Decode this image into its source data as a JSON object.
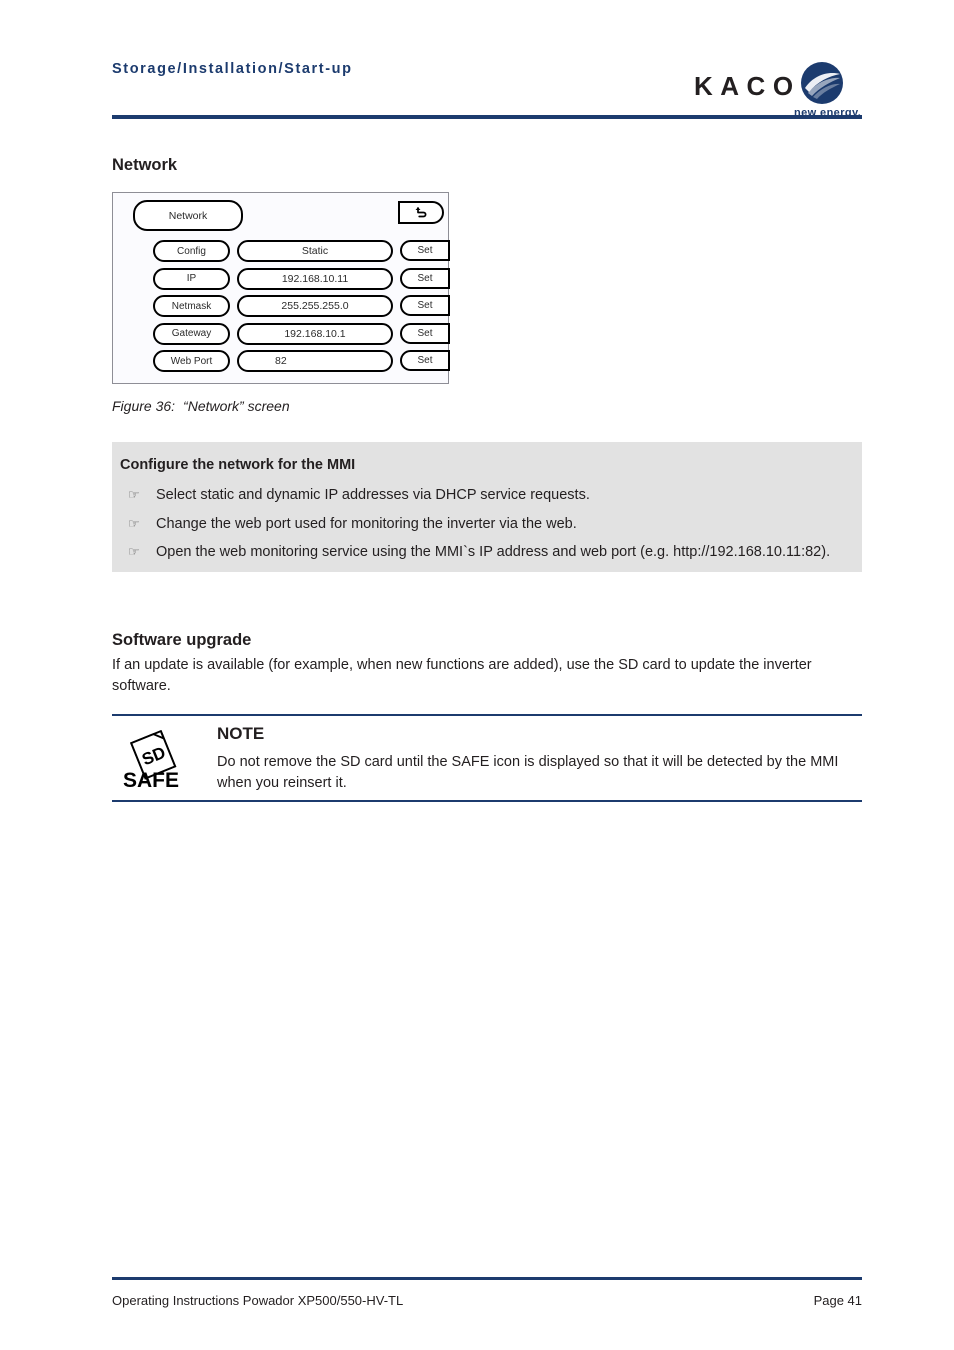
{
  "header": {
    "breadcrumb": "Storage/Installation/Start-up",
    "rule_color": "#1c3b6e"
  },
  "logo": {
    "wordmark": "KACO",
    "tagline": "new energy.",
    "mark_icon": "kaco-globe-icon",
    "mark_color": "#1c3b6e"
  },
  "sections": {
    "network_heading": "Network",
    "software_heading": "Software upgrade",
    "software_paragraph": "If an update is available (for example, when new functions are added), use the SD card to update the inverter software."
  },
  "mmi_screen": {
    "title": "Network",
    "back_button_icon": "undo-arrow-icon",
    "rows": [
      {
        "label": "Config",
        "value": "Static",
        "action": "Set",
        "value_centered": true
      },
      {
        "label": "IP",
        "value": "192.168.10.11",
        "action": "Set",
        "value_centered": true
      },
      {
        "label": "Netmask",
        "value": "255.255.255.0",
        "action": "Set",
        "value_centered": true
      },
      {
        "label": "Gateway",
        "value": "192.168.10.1",
        "action": "Set",
        "value_centered": true
      },
      {
        "label": "Web Port",
        "value": "82",
        "action": "Set",
        "value_centered": false
      }
    ]
  },
  "figure": {
    "label": "Figure 36:",
    "caption": "“Network” screen"
  },
  "info_box": {
    "title": "Configure the network for the MMI",
    "bullet_icon": "pointing-hand-icon",
    "bullet_glyph": "☞",
    "background": "#e2e2e2",
    "items": [
      "Select static and dynamic IP addresses via DHCP service requests.",
      "Change the web port used for monitoring the inverter via the web.",
      "Open the web monitoring service using the MMI`s IP address and web port (e.g. http://192.168.10.11:82)."
    ]
  },
  "note": {
    "title": "NOTE",
    "text": "Do not remove the SD card until the SAFE icon is displayed so that it will be detected by the MMI when you reinsert it.",
    "icon": "sd-safe-icon",
    "icon_card_label": "SD",
    "icon_caption": "SAFE",
    "rule_color": "#1c3b6e"
  },
  "footer": {
    "document": "Operating Instructions Powador XP500/550-HV-TL",
    "page": "Page 41"
  }
}
